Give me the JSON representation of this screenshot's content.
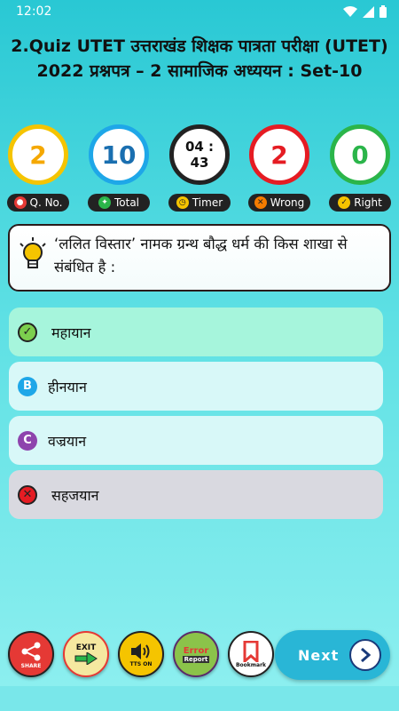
{
  "status_bar": {
    "time": "12:02"
  },
  "quiz": {
    "title": "2.Quiz   UTET उत्तराखंड शिक्षक पात्रता परीक्षा (UTET) 2022 प्रश्नपत्र – 2   सामाजिक अध्ययन : Set-10"
  },
  "stats": [
    {
      "value": "2",
      "label": "Q. No.",
      "color": "#f5c400"
    },
    {
      "value": "10",
      "label": "Total",
      "color": "#1ea7e8"
    },
    {
      "value": "04 : 43",
      "label": "Timer",
      "color": "#222222"
    },
    {
      "value": "2",
      "label": "Wrong",
      "color": "#e51c23"
    },
    {
      "value": "0",
      "label": "Right",
      "color": "#2bb54a"
    }
  ],
  "question": {
    "text": "‘ललित विस्तार’ नामक ग्रन्थ बौद्ध धर्म की किस शाखा से संबंधित है :"
  },
  "options": [
    {
      "text": "महायान",
      "state": "correct",
      "icon": "check-icon",
      "bg": "#a6f5dc"
    },
    {
      "text": "हीनयान",
      "state": "normal",
      "letter": "B",
      "icon_color": "#1ea7e8",
      "bg": "#d8f8f8"
    },
    {
      "text": "वज्रयान",
      "state": "normal",
      "letter": "C",
      "icon_color": "#8e44ad",
      "bg": "#d8f8f8"
    },
    {
      "text": "सहजयान",
      "state": "wrong",
      "icon": "cross-icon",
      "bg": "#d9d9e0"
    }
  ],
  "bottom": {
    "share_label": "SHARE",
    "exit_label": "EXIT",
    "tts_label": "TTS ON",
    "error_label": "Error",
    "report_label": "Report",
    "bookmark_label": "Bookmark",
    "next_label": "Next"
  }
}
